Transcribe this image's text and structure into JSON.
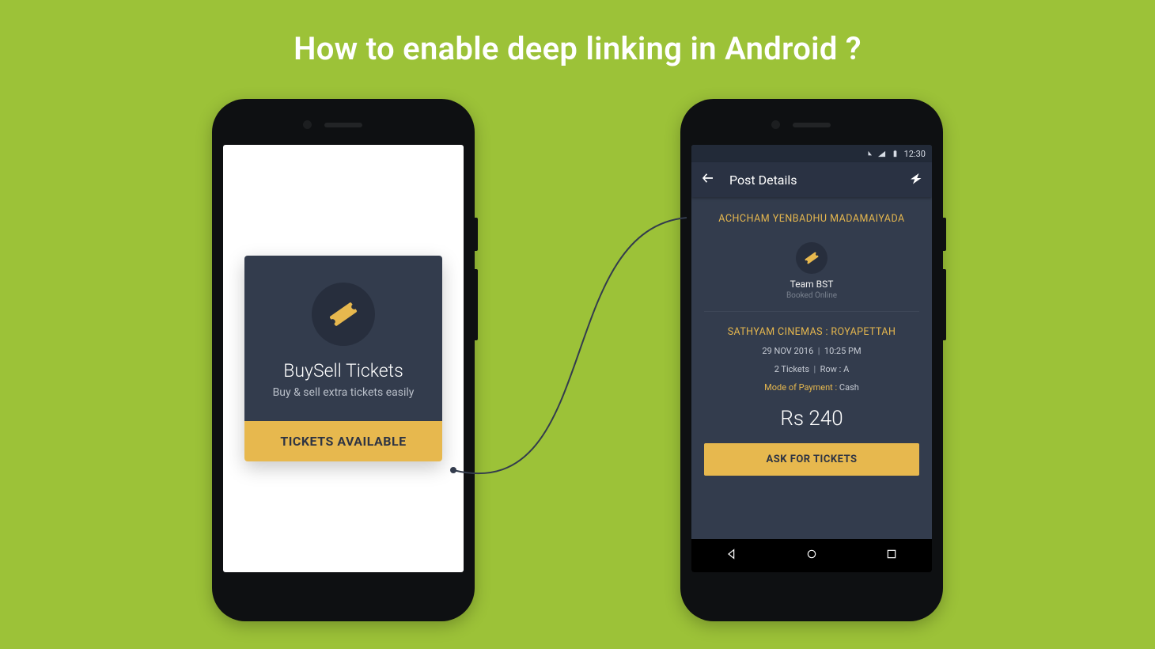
{
  "title": "How to enable deep linking in Android ?",
  "left_phone": {
    "card_title": "BuySell Tickets",
    "card_subtitle": "Buy & sell extra tickets easily",
    "cta": "TICKETS AVAILABLE"
  },
  "right_phone": {
    "statusbar_time": "12:30",
    "appbar_title": "Post Details",
    "movie_title": "ACHCHAM YENBADHU MADAMAIYADA",
    "team_name": "Team BST",
    "booked_label": "Booked Online",
    "venue": "SATHYAM CINEMAS : ROYAPETTAH",
    "date": "29 NOV 2016",
    "time": "10:25 PM",
    "tickets": "2 Tickets",
    "row": "Row : A",
    "mop_label": "Mode of Payment :",
    "mop_value": "Cash",
    "price": "Rs 240",
    "ask_cta": "ASK FOR TICKETS"
  }
}
